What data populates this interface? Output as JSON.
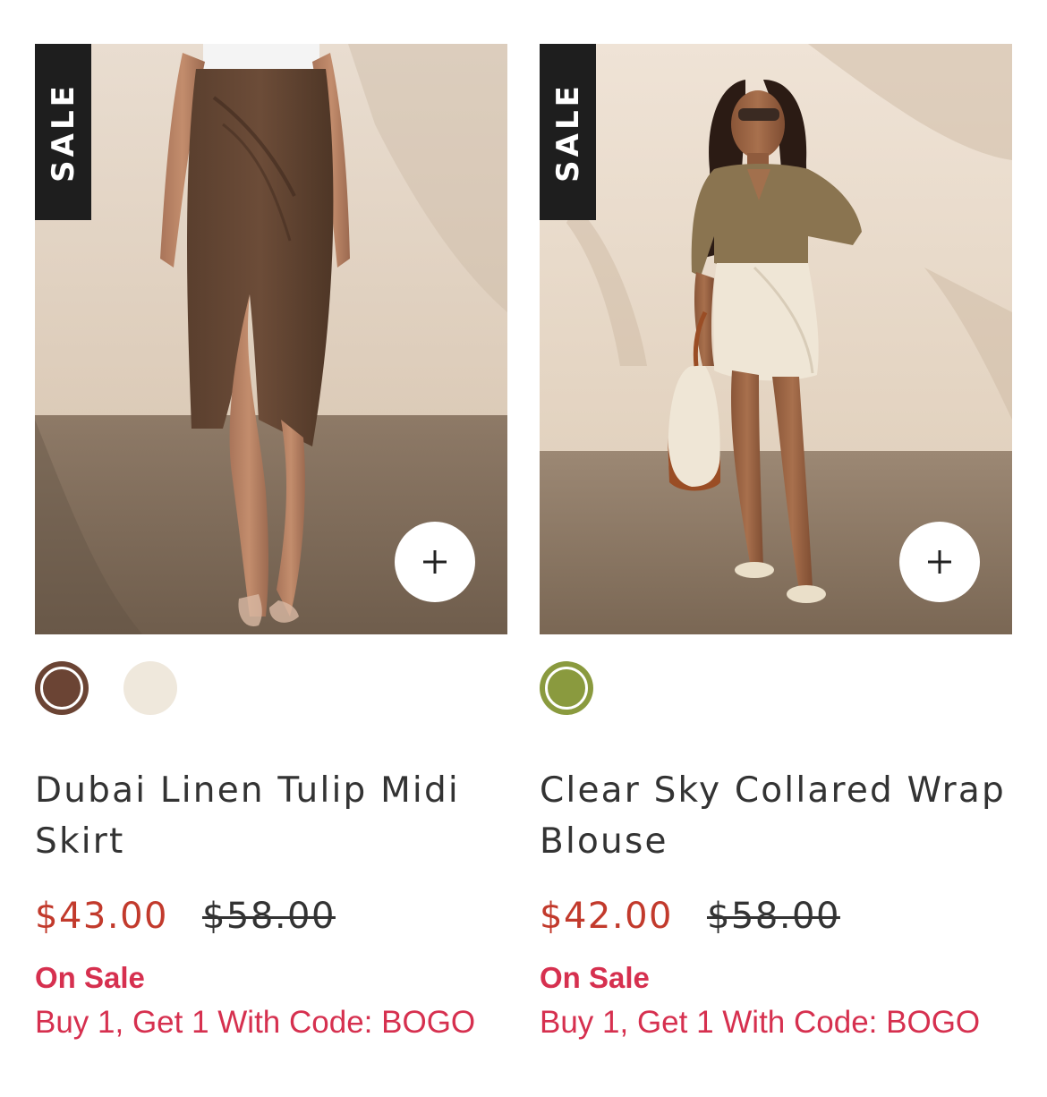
{
  "products": [
    {
      "badge": "SALE",
      "image_icon": "product-photo-skirt",
      "add_icon": "plus-icon",
      "swatches": [
        {
          "color": "#6b4434",
          "selected": true
        },
        {
          "color": "#efe8dc",
          "selected": false
        }
      ],
      "title": "Dubai Linen Tulip Midi Skirt",
      "sale_price": "$43.00",
      "original_price": "$58.00",
      "promo_title": "On Sale",
      "promo_text": "Buy 1, Get 1 With Code: BOGO"
    },
    {
      "badge": "SALE",
      "image_icon": "product-photo-blouse",
      "add_icon": "plus-icon",
      "swatches": [
        {
          "color": "#8a9a3e",
          "selected": true
        }
      ],
      "title": "Clear Sky Collared Wrap Blouse",
      "sale_price": "$42.00",
      "original_price": "$58.00",
      "promo_title": "On Sale",
      "promo_text": "Buy 1, Get 1 With Code: BOGO"
    }
  ],
  "colors": {
    "sale_price": "#c23a2c",
    "promo": "#d6304f",
    "badge_bg": "#1e1e1e",
    "text": "#333333"
  }
}
